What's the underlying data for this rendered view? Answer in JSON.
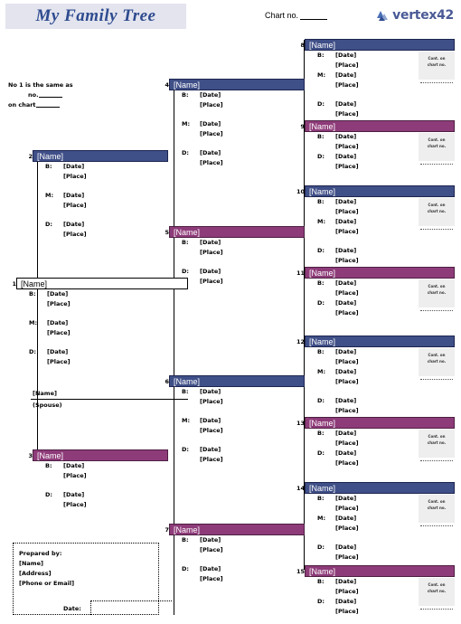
{
  "header": {
    "title": "My Family Tree",
    "chart_no_label": "Chart no.",
    "logo_text": "vertex42",
    "logo_icon": "vertex42-logo-icon"
  },
  "note": {
    "line1": "No 1 is the same as",
    "line2": "no.",
    "line3": "on chart"
  },
  "labels": {
    "birth": "B:",
    "marriage": "M:",
    "death": "D:",
    "date": "[Date]",
    "place": "[Place]",
    "name": "[Name]",
    "spouse": "(Spouse)",
    "cont_line1": "Cont. on",
    "cont_line2": "chart no."
  },
  "prepared": {
    "title": "Prepared by:",
    "name": "[Name]",
    "address": "[Address]",
    "contact": "[Phone or Email]",
    "date_label": "Date:"
  },
  "boxes": [
    {
      "num": "1",
      "name": "[Name]",
      "sex": "self",
      "rows": [
        "B",
        "M",
        "D"
      ],
      "cont": false
    },
    {
      "num": "2",
      "name": "[Name]",
      "sex": "male",
      "rows": [
        "B",
        "M",
        "D"
      ],
      "cont": false
    },
    {
      "num": "3",
      "name": "[Name]",
      "sex": "female",
      "rows": [
        "B",
        "D"
      ],
      "cont": false
    },
    {
      "num": "4",
      "name": "[Name]",
      "sex": "male",
      "rows": [
        "B",
        "M",
        "D"
      ],
      "cont": false
    },
    {
      "num": "5",
      "name": "[Name]",
      "sex": "female",
      "rows": [
        "B",
        "D"
      ],
      "cont": false
    },
    {
      "num": "6",
      "name": "[Name]",
      "sex": "male",
      "rows": [
        "B",
        "M",
        "D"
      ],
      "cont": false
    },
    {
      "num": "7",
      "name": "[Name]",
      "sex": "female",
      "rows": [
        "B",
        "D"
      ],
      "cont": false
    },
    {
      "num": "8",
      "name": "[Name]",
      "sex": "male",
      "rows": [
        "B",
        "M",
        "D"
      ],
      "cont": true
    },
    {
      "num": "9",
      "name": "[Name]",
      "sex": "female",
      "rows": [
        "B",
        "D"
      ],
      "cont": true
    },
    {
      "num": "10",
      "name": "[Name]",
      "sex": "male",
      "rows": [
        "B",
        "M",
        "D"
      ],
      "cont": true
    },
    {
      "num": "11",
      "name": "[Name]",
      "sex": "female",
      "rows": [
        "B",
        "D"
      ],
      "cont": true
    },
    {
      "num": "12",
      "name": "[Name]",
      "sex": "male",
      "rows": [
        "B",
        "M",
        "D"
      ],
      "cont": true
    },
    {
      "num": "13",
      "name": "[Name]",
      "sex": "female",
      "rows": [
        "B",
        "D"
      ],
      "cont": true
    },
    {
      "num": "14",
      "name": "[Name]",
      "sex": "male",
      "rows": [
        "B",
        "M",
        "D"
      ],
      "cont": true
    },
    {
      "num": "15",
      "name": "[Name]",
      "sex": "female",
      "rows": [
        "B",
        "D"
      ],
      "cont": true
    }
  ],
  "spouse_field": {
    "name": "[Name]",
    "caption": "(Spouse)"
  },
  "colors": {
    "male_header": "#3f4f87",
    "female_header": "#8e3b79",
    "title_bg": "#e3e4ee",
    "title_fg": "#2e4b8f",
    "cont_bg": "#eeeeee"
  }
}
